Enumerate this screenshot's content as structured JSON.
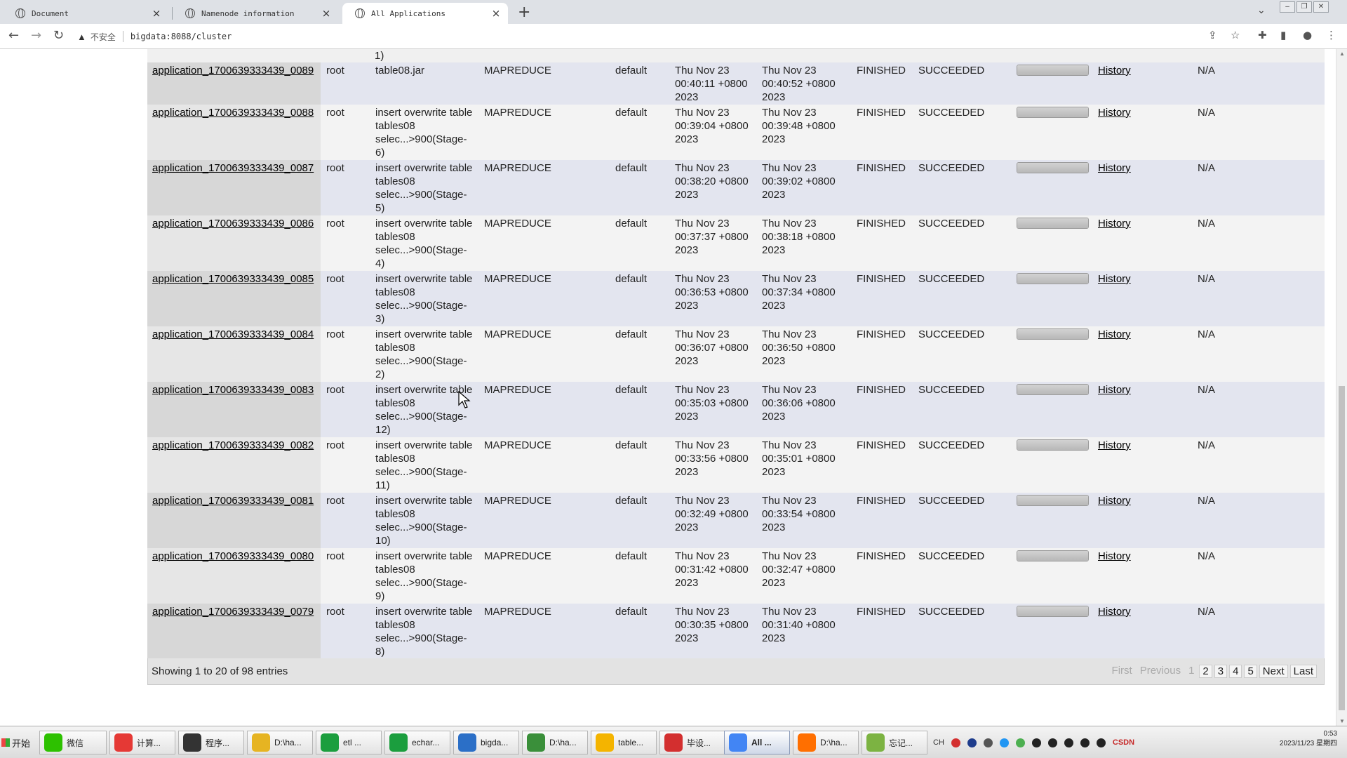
{
  "browser": {
    "tabs": [
      {
        "label": "Document",
        "active": false
      },
      {
        "label": "Namenode information",
        "active": false
      },
      {
        "label": "All Applications",
        "active": true
      }
    ],
    "new_tab_symbol": "+",
    "security_label": "不安全",
    "url": "bigdata:8088/cluster"
  },
  "table": {
    "partial_row_fragment": "1)",
    "rows": [
      {
        "id": "application_1700639333439_0089",
        "user": "root",
        "name": "table08.jar",
        "type": "MAPREDUCE",
        "queue": "default",
        "start": "Thu Nov 23 00:40:11 +0800 2023",
        "finish": "Thu Nov 23 00:40:52 +0800 2023",
        "state": "FINISHED",
        "final_status": "SUCCEEDED",
        "progress": 1.0,
        "tracking": "History",
        "blacklisted": "N/A"
      },
      {
        "id": "application_1700639333439_0088",
        "user": "root",
        "name": "insert overwrite table tables08 selec...>900(Stage-6)",
        "type": "MAPREDUCE",
        "queue": "default",
        "start": "Thu Nov 23 00:39:04 +0800 2023",
        "finish": "Thu Nov 23 00:39:48 +0800 2023",
        "state": "FINISHED",
        "final_status": "SUCCEEDED",
        "progress": 1.0,
        "tracking": "History",
        "blacklisted": "N/A"
      },
      {
        "id": "application_1700639333439_0087",
        "user": "root",
        "name": "insert overwrite table tables08 selec...>900(Stage-5)",
        "type": "MAPREDUCE",
        "queue": "default",
        "start": "Thu Nov 23 00:38:20 +0800 2023",
        "finish": "Thu Nov 23 00:39:02 +0800 2023",
        "state": "FINISHED",
        "final_status": "SUCCEEDED",
        "progress": 1.0,
        "tracking": "History",
        "blacklisted": "N/A"
      },
      {
        "id": "application_1700639333439_0086",
        "user": "root",
        "name": "insert overwrite table tables08 selec...>900(Stage-4)",
        "type": "MAPREDUCE",
        "queue": "default",
        "start": "Thu Nov 23 00:37:37 +0800 2023",
        "finish": "Thu Nov 23 00:38:18 +0800 2023",
        "state": "FINISHED",
        "final_status": "SUCCEEDED",
        "progress": 1.0,
        "tracking": "History",
        "blacklisted": "N/A"
      },
      {
        "id": "application_1700639333439_0085",
        "user": "root",
        "name": "insert overwrite table tables08 selec...>900(Stage-3)",
        "type": "MAPREDUCE",
        "queue": "default",
        "start": "Thu Nov 23 00:36:53 +0800 2023",
        "finish": "Thu Nov 23 00:37:34 +0800 2023",
        "state": "FINISHED",
        "final_status": "SUCCEEDED",
        "progress": 1.0,
        "tracking": "History",
        "blacklisted": "N/A"
      },
      {
        "id": "application_1700639333439_0084",
        "user": "root",
        "name": "insert overwrite table tables08 selec...>900(Stage-2)",
        "type": "MAPREDUCE",
        "queue": "default",
        "start": "Thu Nov 23 00:36:07 +0800 2023",
        "finish": "Thu Nov 23 00:36:50 +0800 2023",
        "state": "FINISHED",
        "final_status": "SUCCEEDED",
        "progress": 1.0,
        "tracking": "History",
        "blacklisted": "N/A"
      },
      {
        "id": "application_1700639333439_0083",
        "user": "root",
        "name": "insert overwrite table tables08 selec...>900(Stage-12)",
        "type": "MAPREDUCE",
        "queue": "default",
        "start": "Thu Nov 23 00:35:03 +0800 2023",
        "finish": "Thu Nov 23 00:36:06 +0800 2023",
        "state": "FINISHED",
        "final_status": "SUCCEEDED",
        "progress": 1.0,
        "tracking": "History",
        "blacklisted": "N/A"
      },
      {
        "id": "application_1700639333439_0082",
        "user": "root",
        "name": "insert overwrite table tables08 selec...>900(Stage-11)",
        "type": "MAPREDUCE",
        "queue": "default",
        "start": "Thu Nov 23 00:33:56 +0800 2023",
        "finish": "Thu Nov 23 00:35:01 +0800 2023",
        "state": "FINISHED",
        "final_status": "SUCCEEDED",
        "progress": 1.0,
        "tracking": "History",
        "blacklisted": "N/A"
      },
      {
        "id": "application_1700639333439_0081",
        "user": "root",
        "name": "insert overwrite table tables08 selec...>900(Stage-10)",
        "type": "MAPREDUCE",
        "queue": "default",
        "start": "Thu Nov 23 00:32:49 +0800 2023",
        "finish": "Thu Nov 23 00:33:54 +0800 2023",
        "state": "FINISHED",
        "final_status": "SUCCEEDED",
        "progress": 1.0,
        "tracking": "History",
        "blacklisted": "N/A"
      },
      {
        "id": "application_1700639333439_0080",
        "user": "root",
        "name": "insert overwrite table tables08 selec...>900(Stage-9)",
        "type": "MAPREDUCE",
        "queue": "default",
        "start": "Thu Nov 23 00:31:42 +0800 2023",
        "finish": "Thu Nov 23 00:32:47 +0800 2023",
        "state": "FINISHED",
        "final_status": "SUCCEEDED",
        "progress": 1.0,
        "tracking": "History",
        "blacklisted": "N/A"
      },
      {
        "id": "application_1700639333439_0079",
        "user": "root",
        "name": "insert overwrite table tables08 selec...>900(Stage-8)",
        "type": "MAPREDUCE",
        "queue": "default",
        "start": "Thu Nov 23 00:30:35 +0800 2023",
        "finish": "Thu Nov 23 00:31:40 +0800 2023",
        "state": "FINISHED",
        "final_status": "SUCCEEDED",
        "progress": 1.0,
        "tracking": "History",
        "blacklisted": "N/A"
      }
    ],
    "footer_info": "Showing 1 to 20 of 98 entries",
    "pager": {
      "first": "First",
      "previous": "Previous",
      "pages": [
        "1",
        "2",
        "3",
        "4",
        "5"
      ],
      "current": "1",
      "next": "Next",
      "last": "Last"
    }
  },
  "taskbar": {
    "start_label": "开始",
    "tasks": [
      {
        "label": "微信",
        "icon": "wechat-icon",
        "color": "#2dc100",
        "active": false
      },
      {
        "label": "计算...",
        "icon": "chrome-icon",
        "color": "#e53935",
        "active": false
      },
      {
        "label": "程序...",
        "icon": "avatar-icon",
        "color": "#333333",
        "active": false
      },
      {
        "label": "D:\\ha...",
        "icon": "folder-icon",
        "color": "#e6b422",
        "active": false
      },
      {
        "label": "etl ...",
        "icon": "pycharm-icon",
        "color": "#1b9e3e",
        "active": false
      },
      {
        "label": "echar...",
        "icon": "pycharm-icon",
        "color": "#1b9e3e",
        "active": false
      },
      {
        "label": "bigda...",
        "icon": "terminal-icon",
        "color": "#2b6fc7",
        "active": false
      },
      {
        "label": "D:\\ha...",
        "icon": "notepad-icon",
        "color": "#3a8f3a",
        "active": false
      },
      {
        "label": "table...",
        "icon": "navicat-icon",
        "color": "#f4b400",
        "active": false
      },
      {
        "label": "毕设...",
        "icon": "browser-icon",
        "color": "#d32f2f",
        "active": false
      },
      {
        "label": "All ...",
        "icon": "chrome-icon",
        "color": "#4285f4",
        "active": true
      },
      {
        "label": "D:\\ha...",
        "icon": "sublime-icon",
        "color": "#ff6f00",
        "active": false
      },
      {
        "label": "忘记...",
        "icon": "app-icon",
        "color": "#7cb342",
        "active": false
      }
    ],
    "tray": {
      "ime": "CH",
      "brand": "CSDN",
      "clock_time": "0:53",
      "clock_date": "2023/11/23 星期四"
    }
  }
}
